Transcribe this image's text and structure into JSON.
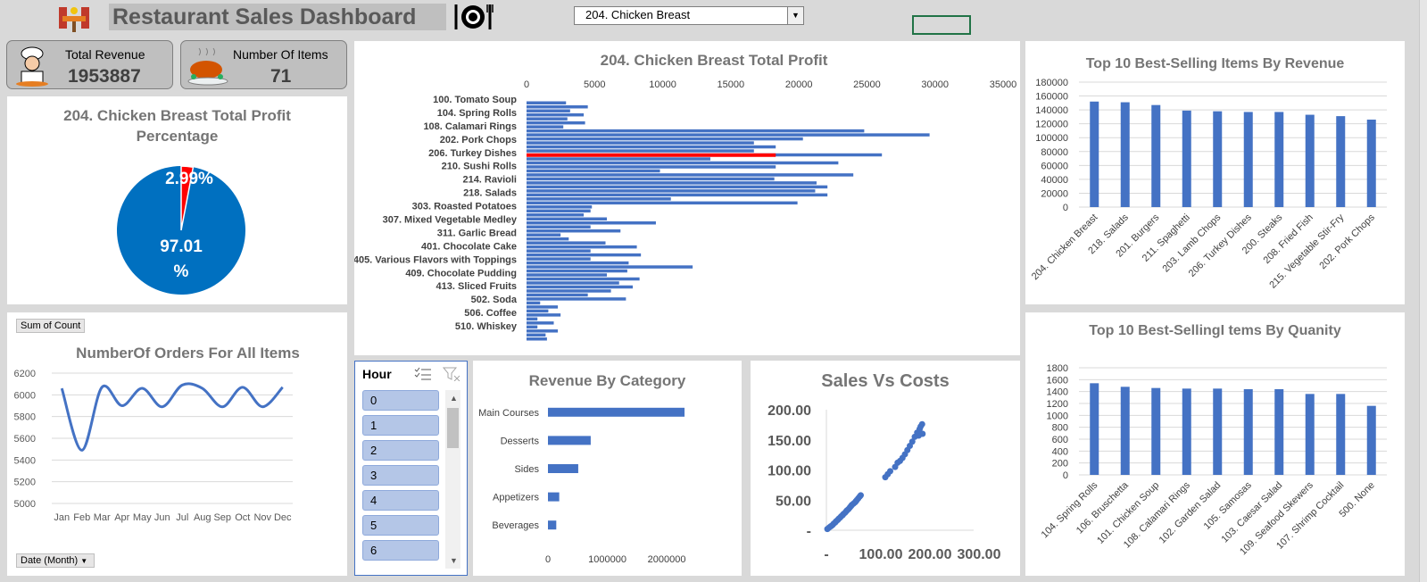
{
  "header": {
    "title": "Restaurant Sales Dashboard",
    "selected_item": "204. Chicken Breast",
    "combo_arrow": "▼"
  },
  "kpis": {
    "revenue_label": "Total Revenue",
    "revenue_value": "1953887",
    "items_label": "Number Of Items",
    "items_value": "71"
  },
  "pie": {
    "title_line1": "204. Chicken Breast Total Profit",
    "title_line2": "Percentage",
    "label_small": "2.99%",
    "label_large_1": "97.01",
    "label_large_2": "%"
  },
  "orders": {
    "field_button": "Sum of Count",
    "title": "NumberOf Orders For All Items",
    "date_button": "Date (Month)",
    "dropdown_arrow": "▼"
  },
  "slicer": {
    "title": "Hour",
    "items": [
      "0",
      "1",
      "2",
      "3",
      "4",
      "5",
      "6"
    ]
  },
  "profit": {
    "title": "204. Chicken Breast Total Profit",
    "ticks": [
      "0",
      "5000",
      "10000",
      "15000",
      "20000",
      "25000",
      "30000",
      "35000"
    ],
    "labels": [
      "100. Tomato Soup",
      "104. Spring Rolls",
      "108. Calamari Rings",
      "202. Pork Chops",
      "206. Turkey Dishes",
      "210. Sushi Rolls",
      "214. Ravioli",
      "218. Salads",
      "303. Roasted Potatoes",
      "307. Mixed Vegetable Medley",
      "311. Garlic Bread",
      "401. Chocolate Cake",
      "405. Various Flavors with Toppings",
      "409. Chocolate Pudding",
      "413. Sliced Fruits",
      "502. Soda",
      "506. Coffee",
      "510. Whiskey"
    ]
  },
  "category": {
    "title": "Revenue By Category",
    "ticks": [
      "0",
      "1000000",
      "2000000"
    ]
  },
  "scatter": {
    "title": "Sales Vs Costs",
    "yticks": [
      "200.00",
      "150.00",
      "100.00",
      "50.00",
      "-"
    ],
    "xticks": [
      "-",
      "100.00",
      "200.00",
      "300.00"
    ]
  },
  "top_revenue": {
    "title": "Top 10 Best-Selling Items By Revenue",
    "yticks": [
      "180000",
      "160000",
      "140000",
      "120000",
      "100000",
      "80000",
      "60000",
      "40000",
      "20000",
      "0"
    ]
  },
  "top_quantity": {
    "title": "Top 10 Best-SellingI tems By Quanity",
    "yticks": [
      "1800",
      "1600",
      "1400",
      "1200",
      "1000",
      "800",
      "600",
      "400",
      "200",
      "0"
    ]
  },
  "colors": {
    "bar": "#4472c4",
    "highlight": "#ff0000",
    "pie_main": "#0070c0",
    "title_gray": "#757575"
  },
  "chart_data": [
    {
      "id": "profit_bars",
      "type": "bar",
      "orientation": "horizontal",
      "title": "204. Chicken Breast Total Profit",
      "xlim": [
        0,
        35000
      ],
      "labeled_categories": [
        "100. Tomato Soup",
        "104. Spring Rolls",
        "108. Calamari Rings",
        "202. Pork Chops",
        "206. Turkey Dishes",
        "210. Sushi Rolls",
        "214. Ravioli",
        "218. Salads",
        "303. Roasted Potatoes",
        "307. Mixed Vegetable Medley",
        "311. Garlic Bread",
        "401. Chocolate Cake",
        "405. Various Flavors with Toppings",
        "409. Chocolate Pudding",
        "413. Sliced Fruits",
        "502. Soda",
        "506. Coffee",
        "510. Whiskey"
      ],
      "values": [
        2900,
        4500,
        3200,
        4200,
        3000,
        4300,
        2700,
        24800,
        29600,
        20300,
        16700,
        18300,
        16700,
        26100,
        13500,
        22900,
        18300,
        9800,
        24000,
        18200,
        21300,
        22100,
        21200,
        22100,
        10600,
        19900,
        4800,
        4700,
        4200,
        5900,
        9500,
        4700,
        6900,
        2500,
        3100,
        5800,
        8100,
        4700,
        8400,
        4700,
        7500,
        12200,
        7400,
        5900,
        8300,
        6800,
        7800,
        6200,
        4500,
        7300,
        1000,
        2300,
        1600,
        2500,
        800,
        2000,
        800,
        2300,
        1400,
        1500
      ],
      "highlight_index": 13,
      "highlight_value": 18300
    },
    {
      "id": "pie_profit_share",
      "type": "pie",
      "title": "204. Chicken Breast Total Profit Percentage",
      "values": [
        2.99,
        97.01
      ]
    },
    {
      "id": "orders_line",
      "type": "line",
      "title": "NumberOf Orders For All Items",
      "categories": [
        "Jan",
        "Feb",
        "Mar",
        "Apr",
        "May",
        "Jun",
        "Jul",
        "Aug",
        "Sep",
        "Oct",
        "Nov",
        "Dec"
      ],
      "values": [
        6060,
        5490,
        6070,
        5900,
        6060,
        5890,
        6090,
        6060,
        5890,
        6070,
        5890,
        6070
      ],
      "ylim": [
        5000,
        6200
      ],
      "yticks": [
        "6200",
        "6000",
        "5800",
        "5600",
        "5400",
        "5200",
        "5000"
      ]
    },
    {
      "id": "revenue_by_category",
      "type": "bar",
      "orientation": "horizontal",
      "title": "Revenue By Category",
      "categories": [
        "Main Courses",
        "Desserts",
        "Sides",
        "Appetizers",
        "Beverages"
      ],
      "values": [
        2300000,
        720000,
        510000,
        190000,
        140000
      ],
      "xlim": [
        0,
        2600000
      ]
    },
    {
      "id": "sales_vs_costs",
      "type": "scatter",
      "title": "Sales Vs Costs",
      "xlim": [
        0,
        300
      ],
      "ylim": [
        0,
        200
      ],
      "points": [
        [
          2,
          2
        ],
        [
          5,
          4
        ],
        [
          8,
          6
        ],
        [
          10,
          7
        ],
        [
          13,
          9
        ],
        [
          15,
          11
        ],
        [
          18,
          13
        ],
        [
          20,
          15
        ],
        [
          23,
          17
        ],
        [
          25,
          19
        ],
        [
          28,
          21
        ],
        [
          30,
          23
        ],
        [
          33,
          25
        ],
        [
          35,
          27
        ],
        [
          38,
          29
        ],
        [
          40,
          31
        ],
        [
          42,
          33
        ],
        [
          45,
          35
        ],
        [
          48,
          38
        ],
        [
          50,
          40
        ],
        [
          52,
          42
        ],
        [
          55,
          44
        ],
        [
          58,
          46
        ],
        [
          60,
          48
        ],
        [
          62,
          50
        ],
        [
          65,
          53
        ],
        [
          68,
          56
        ],
        [
          70,
          58
        ],
        [
          120,
          88
        ],
        [
          125,
          93
        ],
        [
          130,
          98
        ],
        [
          140,
          105
        ],
        [
          145,
          112
        ],
        [
          150,
          115
        ],
        [
          155,
          120
        ],
        [
          160,
          126
        ],
        [
          165,
          133
        ],
        [
          170,
          140
        ],
        [
          175,
          147
        ],
        [
          180,
          155
        ],
        [
          185,
          162
        ],
        [
          190,
          168
        ],
        [
          192,
          172
        ],
        [
          195,
          176
        ],
        [
          188,
          157
        ],
        [
          196,
          160
        ]
      ]
    },
    {
      "id": "top_revenue",
      "type": "bar",
      "title": "Top 10 Best-Selling Items By Revenue",
      "categories": [
        "204. Chicken Breast",
        "218. Salads",
        "201. Burgers",
        "211. Spaghetti",
        "203. Lamb Chops",
        "206. Turkey Dishes",
        "200. Steaks",
        "208. Fried Fish",
        "215. Vegetable Stir-Fry",
        "202. Pork Chops"
      ],
      "values": [
        152000,
        151000,
        147000,
        139000,
        138000,
        137000,
        137000,
        133000,
        131000,
        126000
      ],
      "ylim": [
        0,
        180000
      ]
    },
    {
      "id": "top_quantity",
      "type": "bar",
      "title": "Top 10 Best-SellingI tems By Quanity",
      "categories": [
        "104. Spring Rolls",
        "106. Bruschetta",
        "101. Chicken Soup",
        "108. Calamari Rings",
        "102. Garden Salad",
        "105. Samosas",
        "103. Caesar Salad",
        "109. Seafood Skewers",
        "107. Shrimp Cocktail",
        "500. None"
      ],
      "values": [
        1540,
        1480,
        1460,
        1450,
        1450,
        1440,
        1440,
        1360,
        1360,
        1160
      ],
      "ylim": [
        0,
        1800
      ]
    }
  ]
}
